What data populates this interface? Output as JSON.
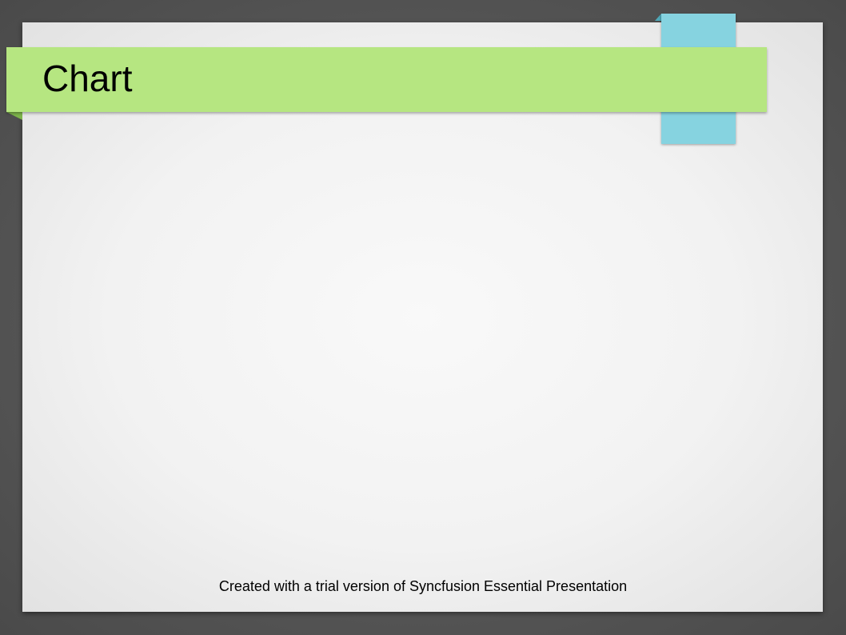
{
  "slide": {
    "title": "Chart"
  },
  "footer": {
    "watermark": "Created with a trial version of Syncfusion Essential Presentation"
  },
  "colors": {
    "banner": "#b6e681",
    "banner_fold": "#7db44a",
    "tab": "#86d3e0",
    "tab_fold": "#4fa8b8",
    "background": "#555555",
    "paper": "#f2f2f2"
  }
}
